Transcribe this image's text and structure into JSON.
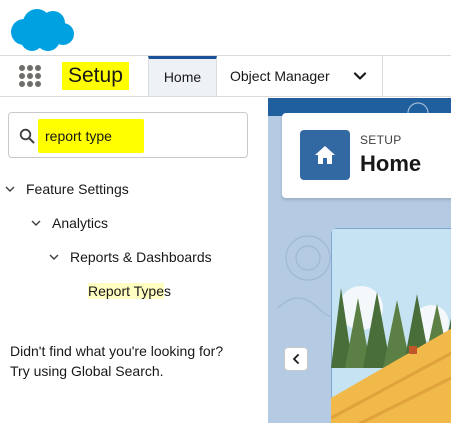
{
  "header": {
    "logo_icon": "salesforce-cloud-logo",
    "brand_color": "#00a1e0"
  },
  "nav": {
    "app_launcher_icon": "app-launcher-grid-icon",
    "app_name": "Setup",
    "tabs": [
      {
        "label": "Home",
        "active": true
      },
      {
        "label": "Object Manager",
        "has_menu": true
      }
    ]
  },
  "sidebar": {
    "search_value": "report type",
    "search_icon": "search-icon",
    "tree": [
      {
        "label": "Feature Settings",
        "expanded": true
      },
      {
        "label": "Analytics",
        "expanded": true
      },
      {
        "label": "Reports & Dashboards",
        "expanded": true
      },
      {
        "label_highlight": "Report Type",
        "label_rest": "s"
      }
    ],
    "help_line1": "Didn't find what you're looking for?",
    "help_line2": "Try using Global Search."
  },
  "main": {
    "breadcrumb": "SETUP",
    "title": "Home",
    "title_icon": "home-icon",
    "collapse_icon": "chevron-left-icon"
  },
  "colors": {
    "highlight": "#ffff00",
    "active_tab_border": "#1b5297",
    "badge": "#3369a3"
  }
}
